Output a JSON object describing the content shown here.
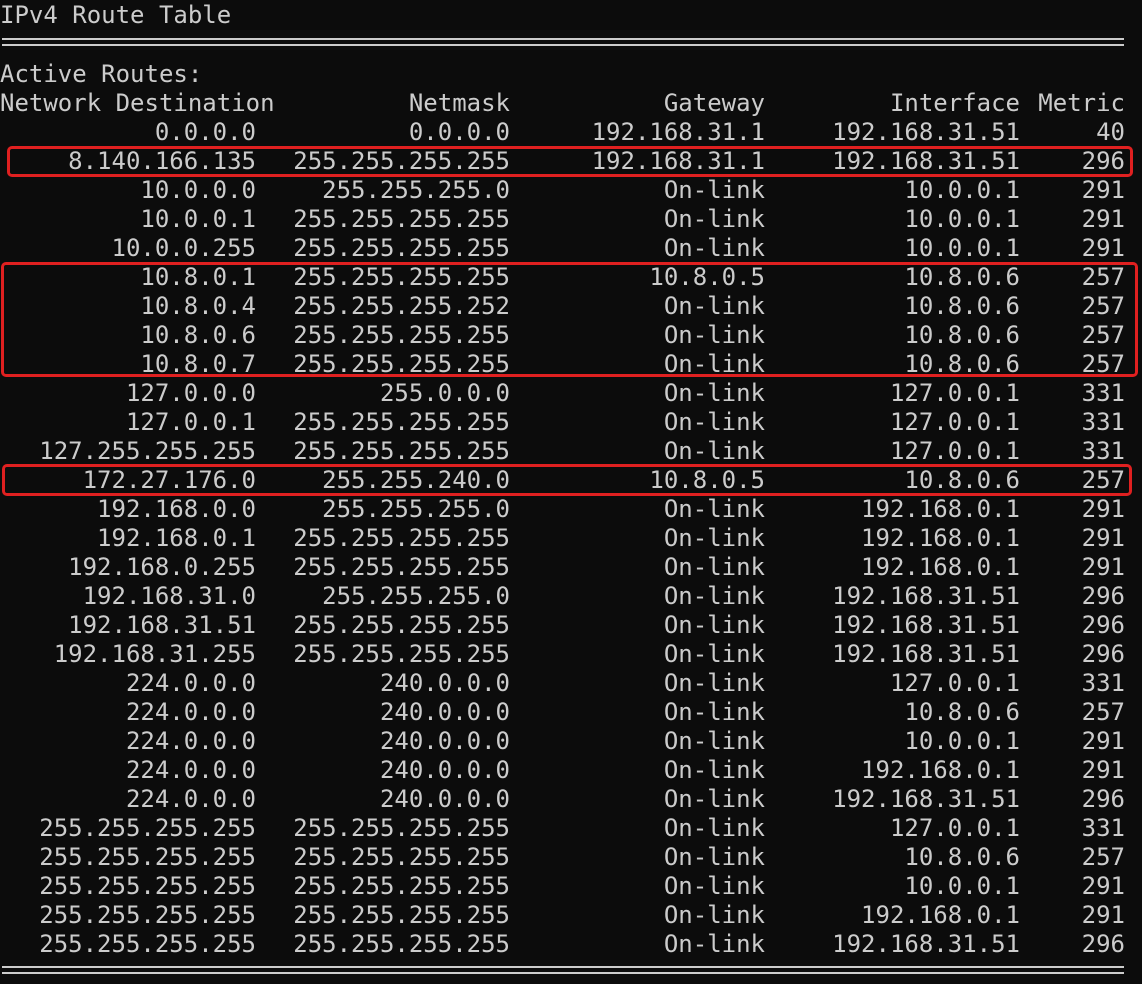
{
  "title": "IPv4 Route Table",
  "active_routes_label": "Active Routes:",
  "headers": {
    "destination": "Network Destination",
    "netmask": "Netmask",
    "gateway": "Gateway",
    "interface": "Interface",
    "metric": "Metric"
  },
  "routes": [
    {
      "dest": "0.0.0.0",
      "mask": "0.0.0.0",
      "gw": "192.168.31.1",
      "iface": "192.168.31.51",
      "metric": "40"
    },
    {
      "dest": "8.140.166.135",
      "mask": "255.255.255.255",
      "gw": "192.168.31.1",
      "iface": "192.168.31.51",
      "metric": "296"
    },
    {
      "dest": "10.0.0.0",
      "mask": "255.255.255.0",
      "gw": "On-link",
      "iface": "10.0.0.1",
      "metric": "291"
    },
    {
      "dest": "10.0.0.1",
      "mask": "255.255.255.255",
      "gw": "On-link",
      "iface": "10.0.0.1",
      "metric": "291"
    },
    {
      "dest": "10.0.0.255",
      "mask": "255.255.255.255",
      "gw": "On-link",
      "iface": "10.0.0.1",
      "metric": "291"
    },
    {
      "dest": "10.8.0.1",
      "mask": "255.255.255.255",
      "gw": "10.8.0.5",
      "iface": "10.8.0.6",
      "metric": "257"
    },
    {
      "dest": "10.8.0.4",
      "mask": "255.255.255.252",
      "gw": "On-link",
      "iface": "10.8.0.6",
      "metric": "257"
    },
    {
      "dest": "10.8.0.6",
      "mask": "255.255.255.255",
      "gw": "On-link",
      "iface": "10.8.0.6",
      "metric": "257"
    },
    {
      "dest": "10.8.0.7",
      "mask": "255.255.255.255",
      "gw": "On-link",
      "iface": "10.8.0.6",
      "metric": "257"
    },
    {
      "dest": "127.0.0.0",
      "mask": "255.0.0.0",
      "gw": "On-link",
      "iface": "127.0.0.1",
      "metric": "331"
    },
    {
      "dest": "127.0.0.1",
      "mask": "255.255.255.255",
      "gw": "On-link",
      "iface": "127.0.0.1",
      "metric": "331"
    },
    {
      "dest": "127.255.255.255",
      "mask": "255.255.255.255",
      "gw": "On-link",
      "iface": "127.0.0.1",
      "metric": "331"
    },
    {
      "dest": "172.27.176.0",
      "mask": "255.255.240.0",
      "gw": "10.8.0.5",
      "iface": "10.8.0.6",
      "metric": "257"
    },
    {
      "dest": "192.168.0.0",
      "mask": "255.255.255.0",
      "gw": "On-link",
      "iface": "192.168.0.1",
      "metric": "291"
    },
    {
      "dest": "192.168.0.1",
      "mask": "255.255.255.255",
      "gw": "On-link",
      "iface": "192.168.0.1",
      "metric": "291"
    },
    {
      "dest": "192.168.0.255",
      "mask": "255.255.255.255",
      "gw": "On-link",
      "iface": "192.168.0.1",
      "metric": "291"
    },
    {
      "dest": "192.168.31.0",
      "mask": "255.255.255.0",
      "gw": "On-link",
      "iface": "192.168.31.51",
      "metric": "296"
    },
    {
      "dest": "192.168.31.51",
      "mask": "255.255.255.255",
      "gw": "On-link",
      "iface": "192.168.31.51",
      "metric": "296"
    },
    {
      "dest": "192.168.31.255",
      "mask": "255.255.255.255",
      "gw": "On-link",
      "iface": "192.168.31.51",
      "metric": "296"
    },
    {
      "dest": "224.0.0.0",
      "mask": "240.0.0.0",
      "gw": "On-link",
      "iface": "127.0.0.1",
      "metric": "331"
    },
    {
      "dest": "224.0.0.0",
      "mask": "240.0.0.0",
      "gw": "On-link",
      "iface": "10.8.0.6",
      "metric": "257"
    },
    {
      "dest": "224.0.0.0",
      "mask": "240.0.0.0",
      "gw": "On-link",
      "iface": "10.0.0.1",
      "metric": "291"
    },
    {
      "dest": "224.0.0.0",
      "mask": "240.0.0.0",
      "gw": "On-link",
      "iface": "192.168.0.1",
      "metric": "291"
    },
    {
      "dest": "224.0.0.0",
      "mask": "240.0.0.0",
      "gw": "On-link",
      "iface": "192.168.31.51",
      "metric": "296"
    },
    {
      "dest": "255.255.255.255",
      "mask": "255.255.255.255",
      "gw": "On-link",
      "iface": "127.0.0.1",
      "metric": "331"
    },
    {
      "dest": "255.255.255.255",
      "mask": "255.255.255.255",
      "gw": "On-link",
      "iface": "10.8.0.6",
      "metric": "257"
    },
    {
      "dest": "255.255.255.255",
      "mask": "255.255.255.255",
      "gw": "On-link",
      "iface": "10.0.0.1",
      "metric": "291"
    },
    {
      "dest": "255.255.255.255",
      "mask": "255.255.255.255",
      "gw": "On-link",
      "iface": "192.168.0.1",
      "metric": "291"
    },
    {
      "dest": "255.255.255.255",
      "mask": "255.255.255.255",
      "gw": "On-link",
      "iface": "192.168.31.51",
      "metric": "296"
    }
  ],
  "highlight_color": "#e02020",
  "text_color": "#cccccc",
  "background_color": "#0c0c0c"
}
